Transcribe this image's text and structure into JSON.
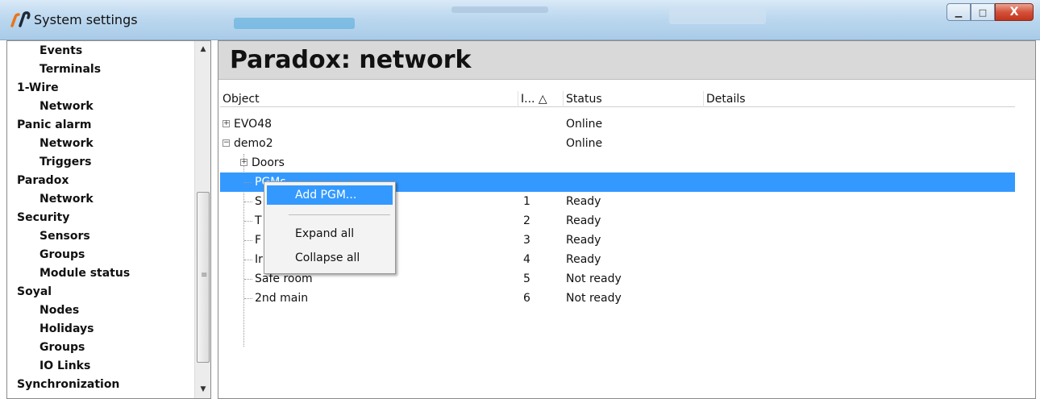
{
  "window": {
    "title": "System settings",
    "minimize_glyph": "▁",
    "maximize_glyph": "□",
    "close_glyph": "X"
  },
  "sidebar": {
    "items": [
      {
        "label": "Events",
        "level": 1
      },
      {
        "label": "Terminals",
        "level": 1
      },
      {
        "label": "1-Wire",
        "level": 0
      },
      {
        "label": "Network",
        "level": 1
      },
      {
        "label": "Panic alarm",
        "level": 0
      },
      {
        "label": "Network",
        "level": 1
      },
      {
        "label": "Triggers",
        "level": 1
      },
      {
        "label": "Paradox",
        "level": 0
      },
      {
        "label": "Network",
        "level": 1
      },
      {
        "label": "Security",
        "level": 0
      },
      {
        "label": "Sensors",
        "level": 1
      },
      {
        "label": "Groups",
        "level": 1
      },
      {
        "label": "Module status",
        "level": 1
      },
      {
        "label": "Soyal",
        "level": 0
      },
      {
        "label": "Nodes",
        "level": 1
      },
      {
        "label": "Holidays",
        "level": 1
      },
      {
        "label": "Groups",
        "level": 1
      },
      {
        "label": "IO Links",
        "level": 1
      },
      {
        "label": "Synchronization",
        "level": 0
      }
    ]
  },
  "main": {
    "title": "Paradox: network",
    "columns": [
      {
        "label": "Object"
      },
      {
        "label": "I... △"
      },
      {
        "label": "Status"
      },
      {
        "label": "Details"
      }
    ],
    "rows": [
      {
        "object": "EVO48",
        "index": "",
        "status": "Online",
        "details": "",
        "expander": "+"
      },
      {
        "object": "demo2",
        "index": "",
        "status": "Online",
        "details": "",
        "expander": "−"
      },
      {
        "object": "Doors",
        "index": "",
        "status": "",
        "details": "",
        "expander": "+"
      },
      {
        "object": "PGMs",
        "index": "",
        "status": "",
        "details": "",
        "selected": true
      },
      {
        "object": "S",
        "index": "1",
        "status": "Ready",
        "details": ""
      },
      {
        "object": "T",
        "index": "2",
        "status": "Ready",
        "details": ""
      },
      {
        "object": "F",
        "index": "3",
        "status": "Ready",
        "details": ""
      },
      {
        "object": "Ir",
        "index": "4",
        "status": "Ready",
        "details": ""
      },
      {
        "object": "Safe room",
        "index": "5",
        "status": "Not ready",
        "details": ""
      },
      {
        "object": "2nd main",
        "index": "6",
        "status": "Not ready",
        "details": ""
      }
    ]
  },
  "context_menu": {
    "items": [
      {
        "label": "Add PGM..."
      },
      {
        "label": "Expand all"
      },
      {
        "label": "Collapse all"
      }
    ]
  },
  "colors": {
    "selection": "#3399ff",
    "header_band": "#d9d9d9"
  }
}
